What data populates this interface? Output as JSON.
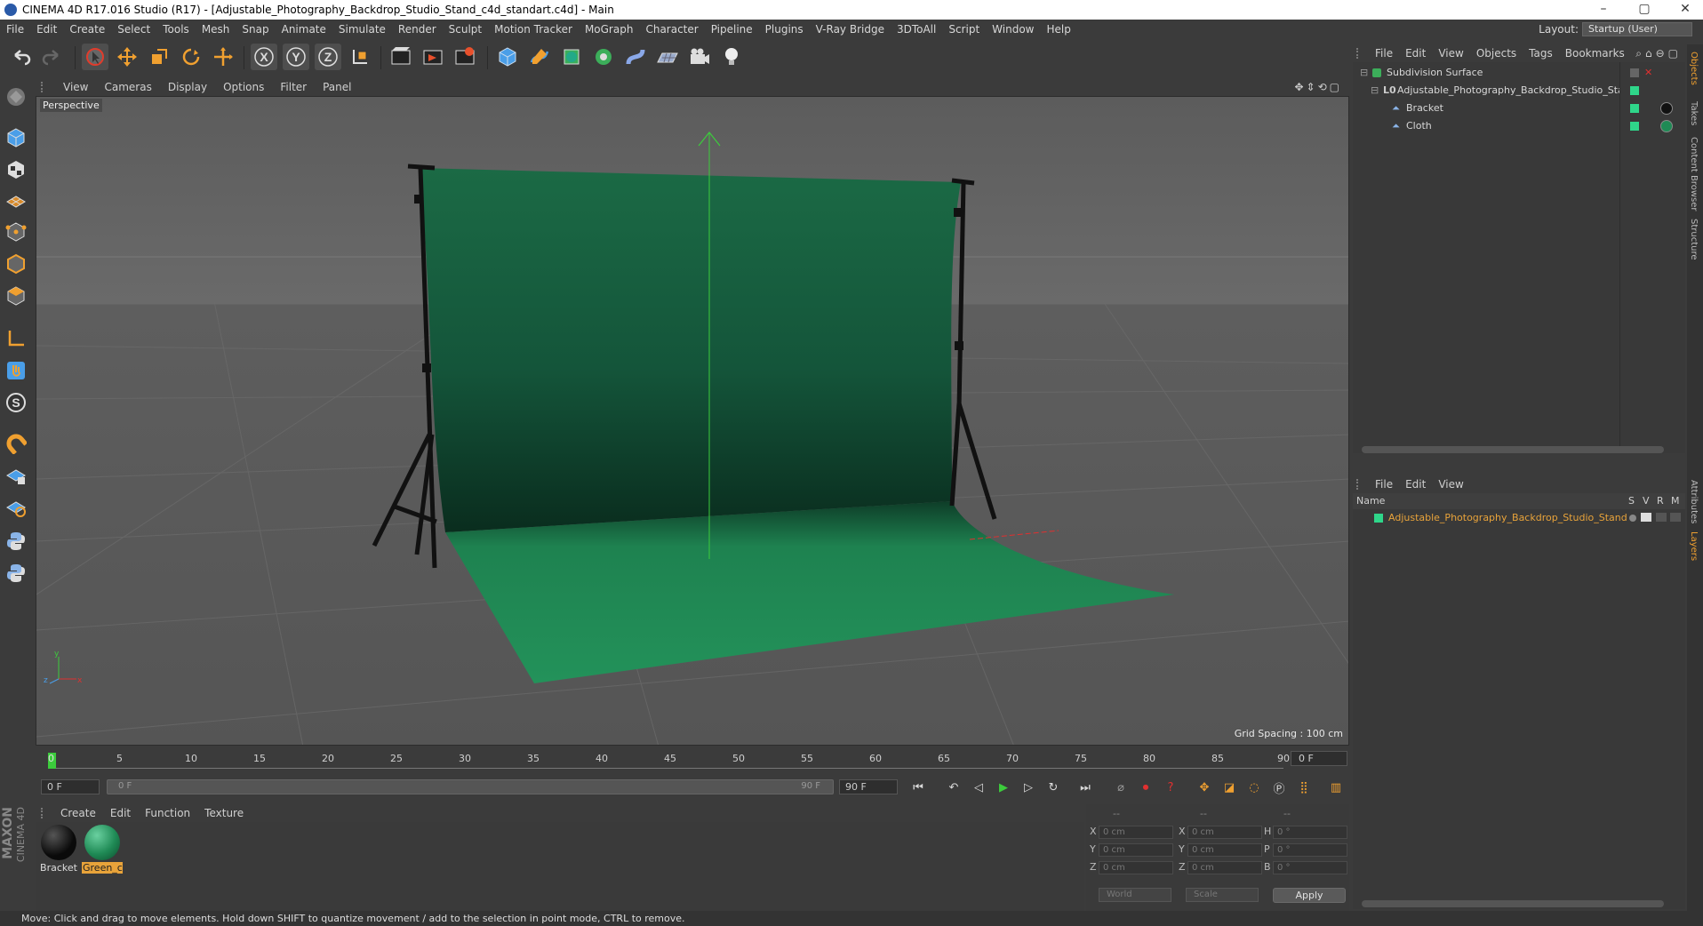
{
  "window": {
    "title": "CINEMA 4D R17.016 Studio (R17) - [Adjustable_Photography_Backdrop_Studio_Stand_c4d_standart.c4d] - Main",
    "controls": [
      "–",
      "▢",
      "✕"
    ]
  },
  "menubar": {
    "items": [
      "File",
      "Edit",
      "Create",
      "Select",
      "Tools",
      "Mesh",
      "Snap",
      "Animate",
      "Simulate",
      "Render",
      "Sculpt",
      "Motion Tracker",
      "MoGraph",
      "Character",
      "Pipeline",
      "Plugins",
      "V-Ray Bridge",
      "3DToAll",
      "Script",
      "Window",
      "Help"
    ],
    "layout_label": "Layout:",
    "layout_value": "Startup (User)"
  },
  "viewport": {
    "menu": [
      "View",
      "Cameras",
      "Display",
      "Options",
      "Filter",
      "Panel"
    ],
    "camera_label": "Perspective",
    "grid_spacing": "Grid Spacing : 100 cm",
    "axis_x": "x",
    "axis_y": "y",
    "axis_z": "z"
  },
  "timeline": {
    "ticks": [
      "0",
      "5",
      "10",
      "15",
      "20",
      "25",
      "30",
      "35",
      "40",
      "45",
      "50",
      "55",
      "60",
      "65",
      "70",
      "75",
      "80",
      "85",
      "90"
    ],
    "current_frame_right": "0 F",
    "start_field": "0 F",
    "range_start": "0 F",
    "range_end": "90 F",
    "end_field": "90 F"
  },
  "materials": {
    "menu": [
      "Create",
      "Edit",
      "Function",
      "Texture"
    ],
    "items": [
      {
        "name": "Bracket",
        "color": "#111111"
      },
      {
        "name": "Green_c",
        "color": "#1f8a55"
      }
    ]
  },
  "coords": {
    "header": [
      "--",
      "--",
      "--"
    ],
    "rows": [
      {
        "a": "X",
        "av": "0 cm",
        "b": "X",
        "bv": "0 cm",
        "c": "H",
        "cv": "0 °"
      },
      {
        "a": "Y",
        "av": "0 cm",
        "b": "Y",
        "bv": "0 cm",
        "c": "P",
        "cv": "0 °"
      },
      {
        "a": "Z",
        "av": "0 cm",
        "b": "Z",
        "bv": "0 cm",
        "c": "B",
        "cv": "0 °"
      }
    ],
    "world": "World",
    "scale": "Scale",
    "apply": "Apply"
  },
  "objects": {
    "menu": [
      "File",
      "Edit",
      "View",
      "Objects",
      "Tags",
      "Bookmarks"
    ],
    "rows": [
      {
        "name": "Subdivision Surface",
        "indent": 0
      },
      {
        "name": "Adjustable_Photography_Backdrop_Studio_Stand",
        "indent": 1
      },
      {
        "name": "Bracket",
        "indent": 2
      },
      {
        "name": "Cloth",
        "indent": 2
      }
    ]
  },
  "layers": {
    "menu": [
      "File",
      "Edit",
      "View"
    ],
    "col_name": "Name",
    "col_s": "S",
    "col_v": "V",
    "col_r": "R",
    "col_m": "M",
    "row": "Adjustable_Photography_Backdrop_Studio_Stand"
  },
  "side_tabs": [
    "Objects",
    "Takes",
    "Content Browser",
    "Structure",
    "Attributes",
    "Layers"
  ],
  "status": "Move: Click and drag to move elements. Hold down SHIFT to quantize movement / add to the selection in point mode, CTRL to remove.",
  "brand": {
    "line1": "MAXON",
    "line2": "CINEMA 4D"
  },
  "colors": {
    "accent": "#e8a33a",
    "green": "#1f8a55",
    "layer_name": "#e8a33a"
  }
}
